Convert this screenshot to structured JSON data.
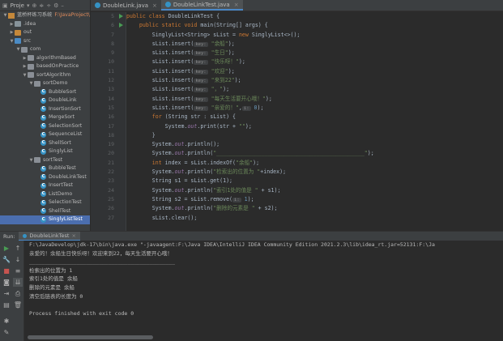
{
  "project_panel": {
    "header_label": "Proje",
    "tree": [
      {
        "label": "蓝桥杯练习系统",
        "extra": "F:\\JavaProject\\",
        "indent": 0,
        "arrow": "down",
        "icon": "proj"
      },
      {
        "label": ".idea",
        "indent": 1,
        "arrow": "right",
        "icon": "folder"
      },
      {
        "label": "out",
        "indent": 1,
        "arrow": "right",
        "icon": "folder orange"
      },
      {
        "label": "src",
        "indent": 1,
        "arrow": "down",
        "icon": "folder blue"
      },
      {
        "label": "com",
        "indent": 2,
        "arrow": "down",
        "icon": "pkg"
      },
      {
        "label": "algorithmBased",
        "indent": 3,
        "arrow": "right",
        "icon": "pkg"
      },
      {
        "label": "basedOnPractice",
        "indent": 3,
        "arrow": "right",
        "icon": "pkg"
      },
      {
        "label": "sortAlgorithm",
        "indent": 3,
        "arrow": "down",
        "icon": "pkg"
      },
      {
        "label": "sortDemo",
        "indent": 4,
        "arrow": "down",
        "icon": "pkg"
      },
      {
        "label": "BubbleSort",
        "indent": 5,
        "arrow": "",
        "icon": "cls"
      },
      {
        "label": "DoubleLink",
        "indent": 5,
        "arrow": "",
        "icon": "cls"
      },
      {
        "label": "InsertionSort",
        "indent": 5,
        "arrow": "",
        "icon": "cls"
      },
      {
        "label": "MergeSort",
        "indent": 5,
        "arrow": "",
        "icon": "cls"
      },
      {
        "label": "SelectionSort",
        "indent": 5,
        "arrow": "",
        "icon": "cls"
      },
      {
        "label": "SequenceList",
        "indent": 5,
        "arrow": "",
        "icon": "cls"
      },
      {
        "label": "ShellSort",
        "indent": 5,
        "arrow": "",
        "icon": "cls"
      },
      {
        "label": "SinglyList",
        "indent": 5,
        "arrow": "",
        "icon": "cls"
      },
      {
        "label": "sortTest",
        "indent": 4,
        "arrow": "down",
        "icon": "pkg"
      },
      {
        "label": "BubbleTest",
        "indent": 5,
        "arrow": "",
        "icon": "cls"
      },
      {
        "label": "DoubleLinkTest",
        "indent": 5,
        "arrow": "",
        "icon": "cls"
      },
      {
        "label": "InsertTest",
        "indent": 5,
        "arrow": "",
        "icon": "cls"
      },
      {
        "label": "ListDemo",
        "indent": 5,
        "arrow": "",
        "icon": "cls"
      },
      {
        "label": "SelectionTest",
        "indent": 5,
        "arrow": "",
        "icon": "cls"
      },
      {
        "label": "ShellTest",
        "indent": 5,
        "arrow": "",
        "icon": "cls"
      },
      {
        "label": "SinglyListTest",
        "indent": 5,
        "arrow": "",
        "icon": "cls",
        "selected": true
      }
    ]
  },
  "editor": {
    "tabs": [
      {
        "label": "DoubleLink.java",
        "active": false
      },
      {
        "label": "DoubleLinkTest.java",
        "active": true
      }
    ],
    "line_numbers": [
      "5",
      "6",
      "7",
      "8",
      "9",
      "10",
      "11",
      "12",
      "13",
      "14",
      "15",
      "16",
      "17",
      "18",
      "19",
      "20",
      "21",
      "22",
      "23",
      "24",
      "25",
      "26",
      "27"
    ],
    "run_marker_lines": [
      "5",
      "6"
    ],
    "lines": [
      [
        {
          "t": "kw",
          "v": "public class "
        },
        {
          "t": "",
          "v": "DoubleLinkTest {"
        }
      ],
      [
        {
          "t": "",
          "v": "    "
        },
        {
          "t": "kw",
          "v": "public static void "
        },
        {
          "t": "",
          "v": "main(String[] args) {"
        }
      ],
      [
        {
          "t": "",
          "v": "        SinglyList<String> sList = "
        },
        {
          "t": "kw",
          "v": "new "
        },
        {
          "t": "",
          "v": "SinglyList<>();"
        }
      ],
      [
        {
          "t": "",
          "v": "        sList.insert("
        },
        {
          "t": "hint",
          "v": "key:"
        },
        {
          "t": "str",
          "v": " \"余船\""
        },
        {
          "t": "",
          "v": ");"
        }
      ],
      [
        {
          "t": "",
          "v": "        sList.insert("
        },
        {
          "t": "hint",
          "v": "key:"
        },
        {
          "t": "str",
          "v": " \"生日\""
        },
        {
          "t": "",
          "v": ");"
        }
      ],
      [
        {
          "t": "",
          "v": "        sList.insert("
        },
        {
          "t": "hint",
          "v": "key:"
        },
        {
          "t": "str",
          "v": " \"快乐呀！\""
        },
        {
          "t": "",
          "v": ");"
        }
      ],
      [
        {
          "t": "",
          "v": "        sList.insert("
        },
        {
          "t": "hint",
          "v": "key:"
        },
        {
          "t": "str",
          "v": " \"欢迎\""
        },
        {
          "t": "",
          "v": ");"
        }
      ],
      [
        {
          "t": "",
          "v": "        sList.insert("
        },
        {
          "t": "hint",
          "v": "key:"
        },
        {
          "t": "str",
          "v": " \"来到22\""
        },
        {
          "t": "",
          "v": ");"
        }
      ],
      [
        {
          "t": "",
          "v": "        sList.insert("
        },
        {
          "t": "hint",
          "v": "key:"
        },
        {
          "t": "str",
          "v": " \"，\""
        },
        {
          "t": "",
          "v": ");"
        }
      ],
      [
        {
          "t": "",
          "v": "        sList.insert("
        },
        {
          "t": "hint",
          "v": "key:"
        },
        {
          "t": "str",
          "v": " \"每天生活要开心哦！\""
        },
        {
          "t": "",
          "v": ");"
        }
      ],
      [
        {
          "t": "",
          "v": "        sList.insert("
        },
        {
          "t": "hint",
          "v": "key:"
        },
        {
          "t": "str",
          "v": " \"亲爱的！\""
        },
        {
          "t": "",
          "v": ","
        },
        {
          "t": "hint",
          "v": "i:"
        },
        {
          "t": "num",
          "v": " 0"
        },
        {
          "t": "",
          "v": ");"
        }
      ],
      [
        {
          "t": "",
          "v": "        "
        },
        {
          "t": "kw",
          "v": "for "
        },
        {
          "t": "",
          "v": "(String str : sList) {"
        }
      ],
      [
        {
          "t": "",
          "v": "            System."
        },
        {
          "t": "fld",
          "v": "out"
        },
        {
          "t": "",
          "v": ".print(str + "
        },
        {
          "t": "str",
          "v": "\"\""
        },
        {
          "t": "",
          "v": ");"
        }
      ],
      [
        {
          "t": "",
          "v": "        }"
        }
      ],
      [
        {
          "t": "",
          "v": "        System."
        },
        {
          "t": "fld",
          "v": "out"
        },
        {
          "t": "",
          "v": ".println();"
        }
      ],
      [
        {
          "t": "",
          "v": "        System."
        },
        {
          "t": "fld",
          "v": "out"
        },
        {
          "t": "",
          "v": ".println("
        },
        {
          "t": "str",
          "v": "\"______________________________________________\""
        },
        {
          "t": "",
          "v": ");"
        }
      ],
      [
        {
          "t": "",
          "v": "        "
        },
        {
          "t": "kw",
          "v": "int "
        },
        {
          "t": "",
          "v": "index = sList.indexOf("
        },
        {
          "t": "str",
          "v": "\"余船\""
        },
        {
          "t": "",
          "v": ");"
        }
      ],
      [
        {
          "t": "",
          "v": "        System."
        },
        {
          "t": "fld",
          "v": "out"
        },
        {
          "t": "",
          "v": ".println("
        },
        {
          "t": "str",
          "v": "\"检索出的位置为 \""
        },
        {
          "t": "",
          "v": "+index);"
        }
      ],
      [
        {
          "t": "",
          "v": "        String s1 = sList.get(1);"
        }
      ],
      [
        {
          "t": "",
          "v": "        System."
        },
        {
          "t": "fld",
          "v": "out"
        },
        {
          "t": "",
          "v": ".println("
        },
        {
          "t": "str",
          "v": "\"索引1处的值是 \""
        },
        {
          "t": "",
          "v": " + s1);"
        }
      ],
      [
        {
          "t": "",
          "v": "        String s2 = sList.remove("
        },
        {
          "t": "hint",
          "v": "i:"
        },
        {
          "t": "num",
          "v": " 1"
        },
        {
          "t": "",
          "v": ");"
        }
      ],
      [
        {
          "t": "",
          "v": "        System."
        },
        {
          "t": "fld",
          "v": "out"
        },
        {
          "t": "",
          "v": ".println("
        },
        {
          "t": "str",
          "v": "\"删除的元素是 \""
        },
        {
          "t": "",
          "v": " + s2);"
        }
      ],
      [
        {
          "t": "",
          "v": "        sList.clear();"
        }
      ]
    ]
  },
  "run_panel": {
    "run_label": "Run:",
    "tab_label": "DoubleLinkTest",
    "console_lines": [
      "F:\\JavaDevelop\\jdk-17\\bin\\java.exe \"-javaagent:F:\\Java IDEA\\IntelliJ IDEA Community Edition 2021.2.3\\lib\\idea_rt.jar=52131:F:\\Ja",
      "亲爱的！余船生日快乐呀！欢迎来到22，每天生活要开心哦！",
      "______________________________________________",
      "检索出的位置为 1",
      "索引1处的值是 余船",
      "删除的元素是 余船",
      "清空后链表的长度为 0",
      "",
      "Process finished with exit code 0"
    ]
  }
}
